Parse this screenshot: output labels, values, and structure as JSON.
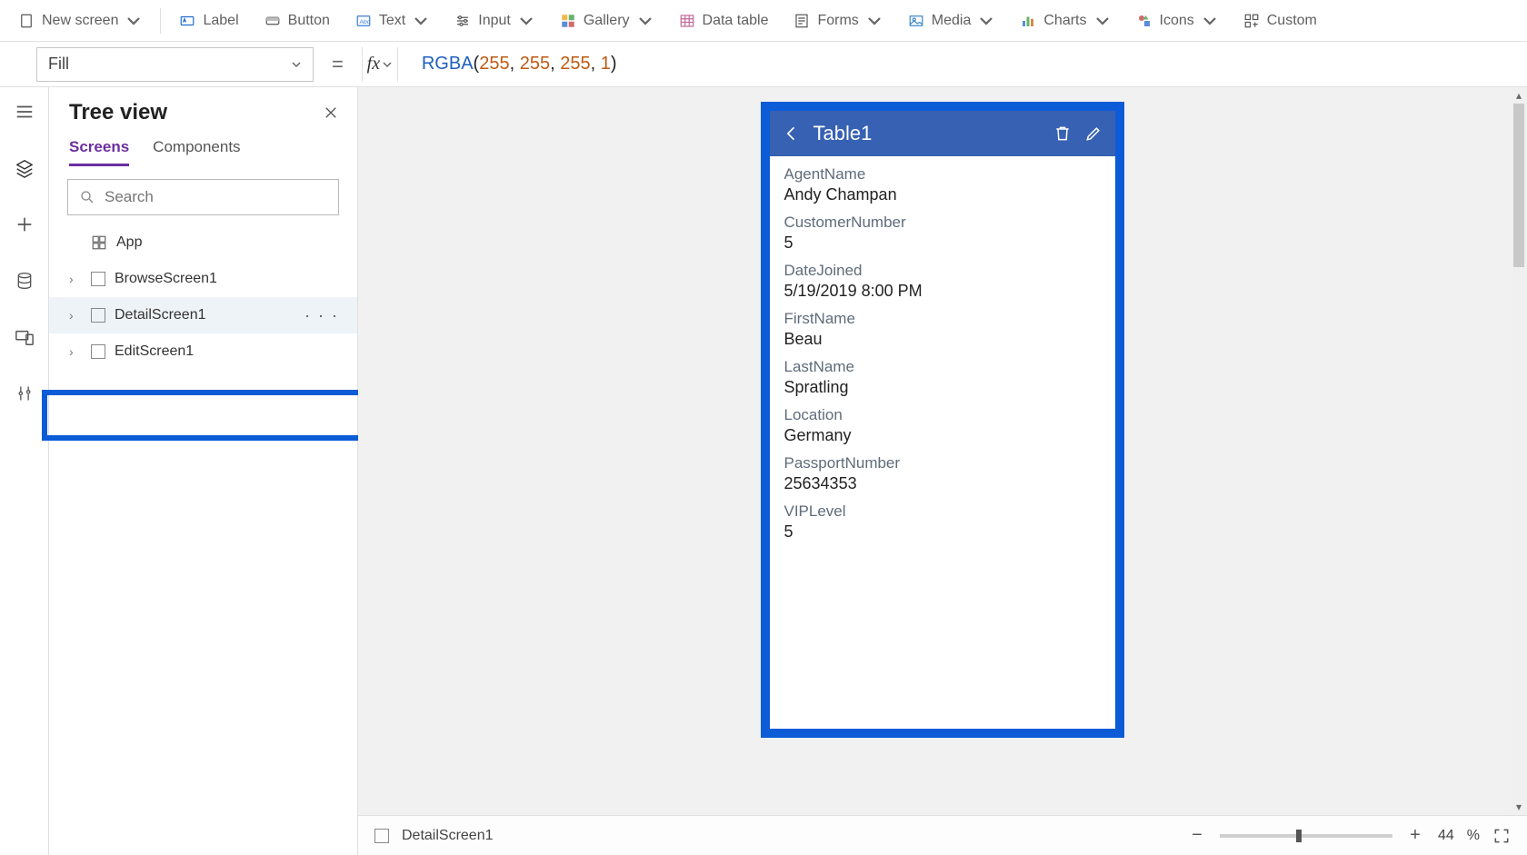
{
  "ribbon": {
    "new_screen": "New screen",
    "label": "Label",
    "button": "Button",
    "text": "Text",
    "input": "Input",
    "gallery": "Gallery",
    "data_table": "Data table",
    "forms": "Forms",
    "media": "Media",
    "charts": "Charts",
    "icons": "Icons",
    "custom": "Custom"
  },
  "formula": {
    "property": "Fill",
    "fx": "fx",
    "func": "RGBA",
    "args": [
      "255",
      "255",
      "255",
      "1"
    ]
  },
  "tree": {
    "title": "Tree view",
    "tabs": {
      "screens": "Screens",
      "components": "Components"
    },
    "search_placeholder": "Search",
    "app": "App",
    "items": [
      {
        "label": "BrowseScreen1"
      },
      {
        "label": "DetailScreen1"
      },
      {
        "label": "EditScreen1"
      }
    ]
  },
  "phone": {
    "title": "Table1",
    "fields": [
      {
        "label": "AgentName",
        "value": "Andy Champan"
      },
      {
        "label": "CustomerNumber",
        "value": "5"
      },
      {
        "label": "DateJoined",
        "value": "5/19/2019 8:00 PM"
      },
      {
        "label": "FirstName",
        "value": "Beau"
      },
      {
        "label": "LastName",
        "value": "Spratling"
      },
      {
        "label": "Location",
        "value": "Germany"
      },
      {
        "label": "PassportNumber",
        "value": "25634353"
      },
      {
        "label": "VIPLevel",
        "value": "5"
      }
    ]
  },
  "status": {
    "screen": "DetailScreen1",
    "zoom": "44",
    "pct": "%"
  }
}
